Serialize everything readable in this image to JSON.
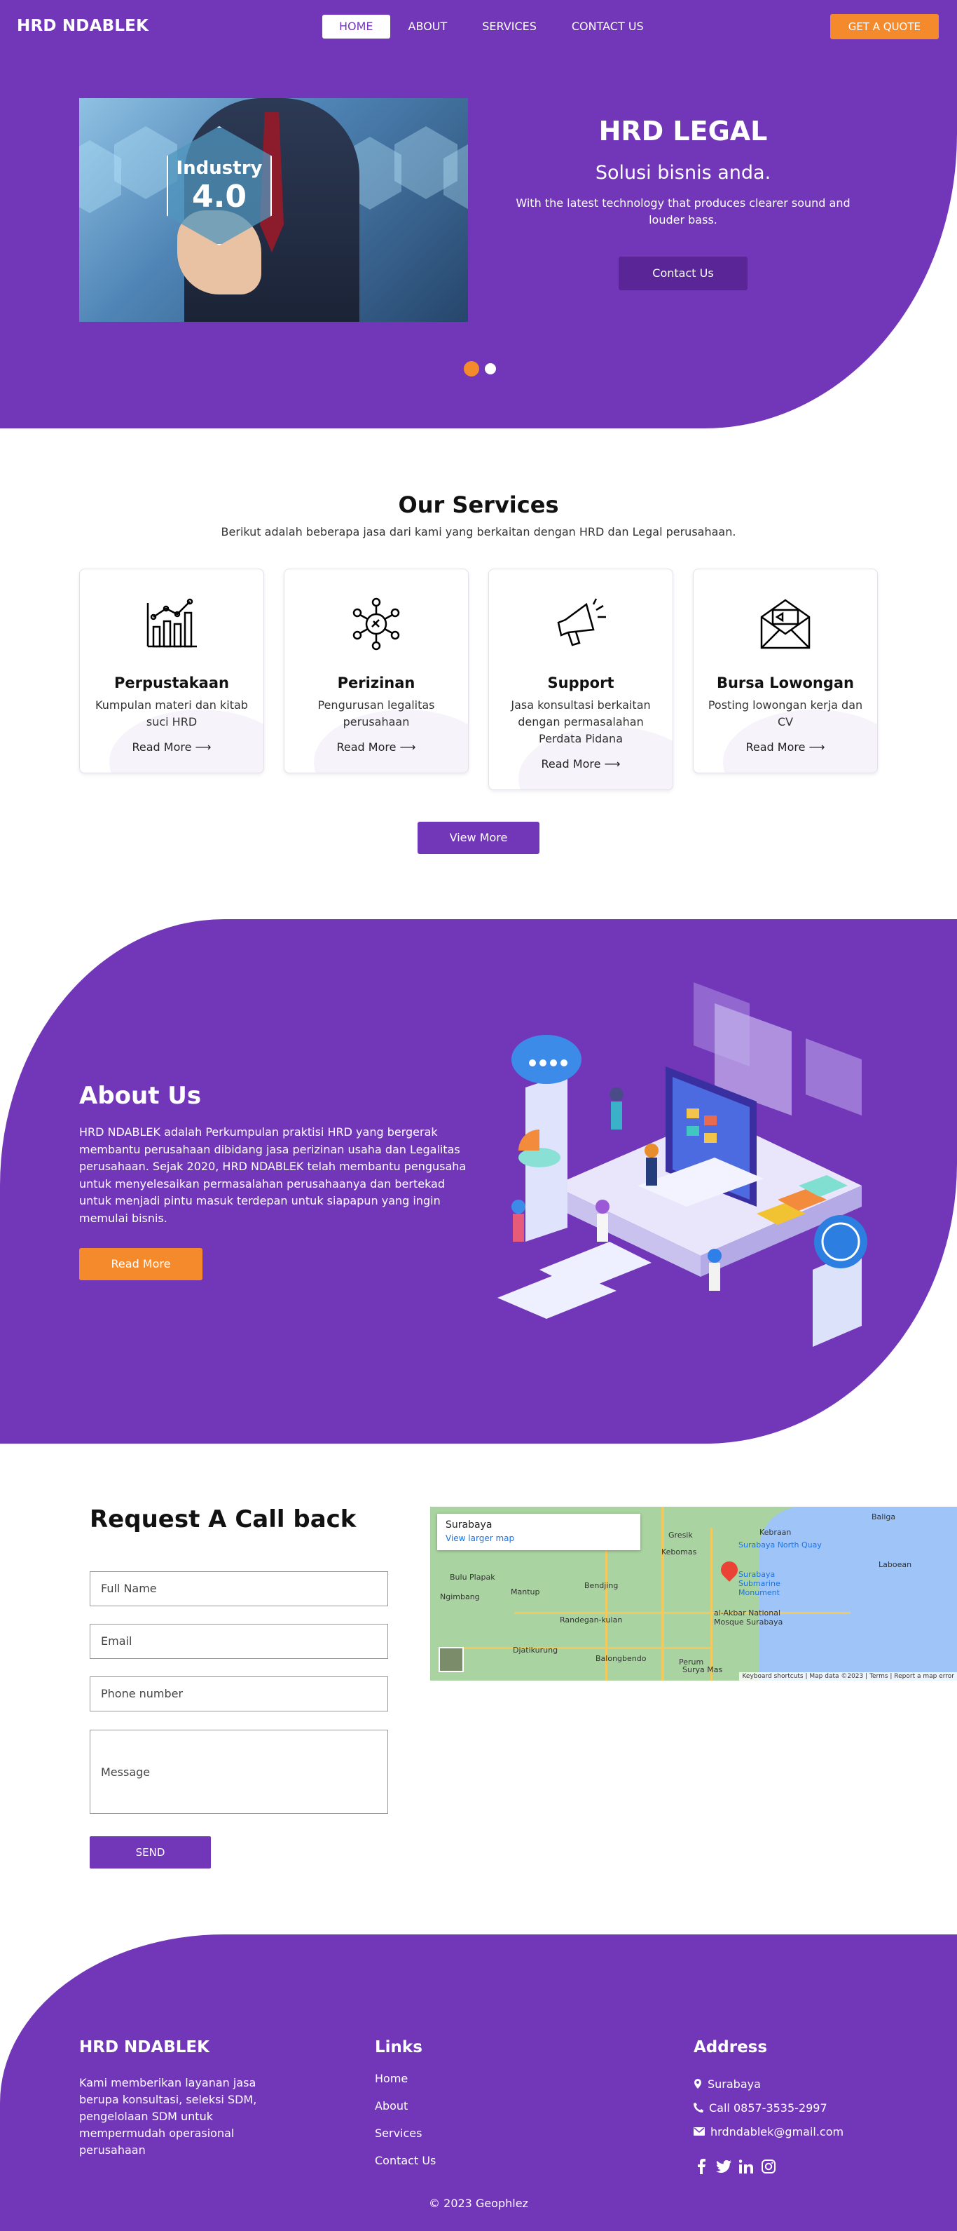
{
  "nav": {
    "brand": "HRD NDABLEK",
    "items": [
      {
        "label": "HOME",
        "active": true
      },
      {
        "label": "ABOUT",
        "active": false
      },
      {
        "label": "SERVICES",
        "active": false
      },
      {
        "label": "CONTACT US",
        "active": false
      }
    ],
    "quote_button": "GET A QUOTE"
  },
  "hero": {
    "image_caption_line1": "Industry",
    "image_caption_line2": "4.0",
    "title": "HRD LEGAL",
    "subtitle": "Solusi bisnis anda.",
    "description": "With the latest technology that produces clearer sound and louder bass.",
    "button": "Contact Us",
    "slides": 2,
    "active_slide": 1
  },
  "services": {
    "title": "Our Services",
    "subtitle": "Berikut adalah beberapa jasa dari kami yang berkaitan dengan HRD dan Legal perusahaan.",
    "cards": [
      {
        "icon": "chart-icon",
        "title": "Perpustakaan",
        "description": "Kumpulan materi dan kitab suci HRD",
        "link": "Read More"
      },
      {
        "icon": "network-icon",
        "title": "Perizinan",
        "description": "Pengurusan legalitas perusahaan",
        "link": "Read More"
      },
      {
        "icon": "megaphone-icon",
        "title": "Support",
        "description": "Jasa konsultasi berkaitan dengan permasalahan Perdata Pidana",
        "link": "Read More"
      },
      {
        "icon": "envelope-icon",
        "title": "Bursa Lowongan",
        "description": "Posting lowongan kerja dan CV",
        "link": "Read More"
      }
    ],
    "view_more": "View More"
  },
  "about": {
    "title": "About Us",
    "text": "HRD NDABLEK adalah Perkumpulan praktisi HRD yang bergerak membantu perusahaan dibidang jasa perizinan usaha dan Legalitas perusahaan. Sejak 2020, HRD NDABLEK telah membantu pengusaha untuk menyelesaikan permasalahan perusahaanya dan bertekad untuk menjadi pintu masuk terdepan untuk siapapun yang ingin memulai bisnis.",
    "button": "Read More"
  },
  "callback": {
    "title": "Request A Call back",
    "fields": {
      "name": "Full Name",
      "email": "Email",
      "phone": "Phone number",
      "message": "Message"
    },
    "send": "SEND"
  },
  "map": {
    "place": "Surabaya",
    "larger_link": "View larger map",
    "labels": [
      "Gresik",
      "Kebomas",
      "Kebraan",
      "Surabaya North Quay",
      "Surabaya Submarine Monument",
      "Baliga",
      "Laboean",
      "Bulu Plapak",
      "Mantup",
      "Bendjing",
      "Ngimbang",
      "Randegan-kulan",
      "al-Akbar National Mosque Surabaya",
      "Djatikurung",
      "Balongbendo",
      "Surya Mas",
      "Perum"
    ],
    "footer": "Keyboard shortcuts | Map data ©2023 | Terms | Report a map error"
  },
  "footer": {
    "brand": "HRD NDABLEK",
    "about": "Kami memberikan layanan jasa berupa konsultasi, seleksi SDM, pengelolaan SDM untuk mempermudah operasional perusahaan",
    "links_title": "Links",
    "links": [
      "Home",
      "About",
      "Services",
      "Contact Us"
    ],
    "address_title": "Address",
    "address": [
      {
        "icon": "map-pin-icon",
        "text": "Surabaya"
      },
      {
        "icon": "phone-icon",
        "text": "Call 0857-3535-2997"
      },
      {
        "icon": "mail-icon",
        "text": "hrdndablek@gmail.com"
      }
    ],
    "social": [
      "facebook-icon",
      "twitter-icon",
      "linkedin-icon",
      "instagram-icon"
    ],
    "copyright": "© 2023 Geophlez"
  },
  "colors": {
    "primary": "#7236b8",
    "accent": "#f58a2c",
    "dark_button": "#5a2597"
  }
}
